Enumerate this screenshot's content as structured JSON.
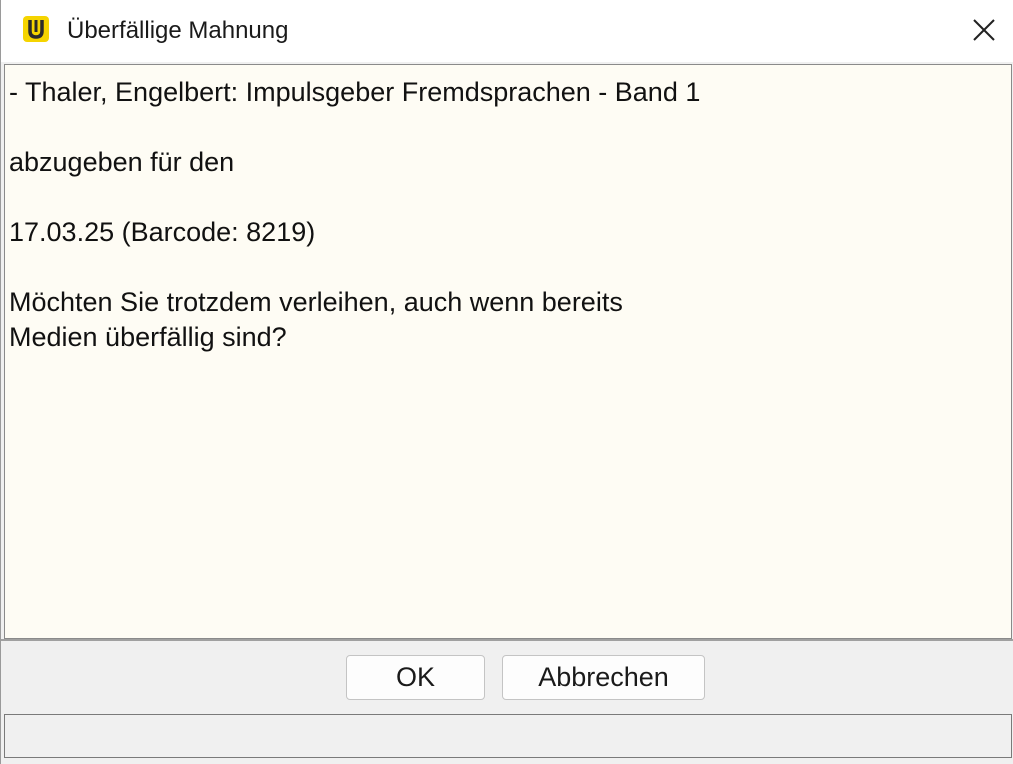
{
  "window": {
    "title": "Überfällige Mahnung",
    "app_icon": "app-logo-icon",
    "close_icon": "close-icon",
    "close_label": "✕"
  },
  "message": {
    "text": "- Thaler, Engelbert: Impulsgeber Fremdsprachen - Band 1\n\nabzugeben für den\n\n17.03.25 (Barcode: 8219)\n\nMöchten Sie trotzdem verleihen, auch wenn bereits\nMedien überfällig sind?"
  },
  "buttons": {
    "ok_label": "OK",
    "cancel_label": "Abbrechen"
  },
  "statusbar": {
    "text": ""
  },
  "colors": {
    "message_background": "#fefcf4",
    "icon_yellow": "#f5d400",
    "icon_dark": "#2b2b2b"
  }
}
